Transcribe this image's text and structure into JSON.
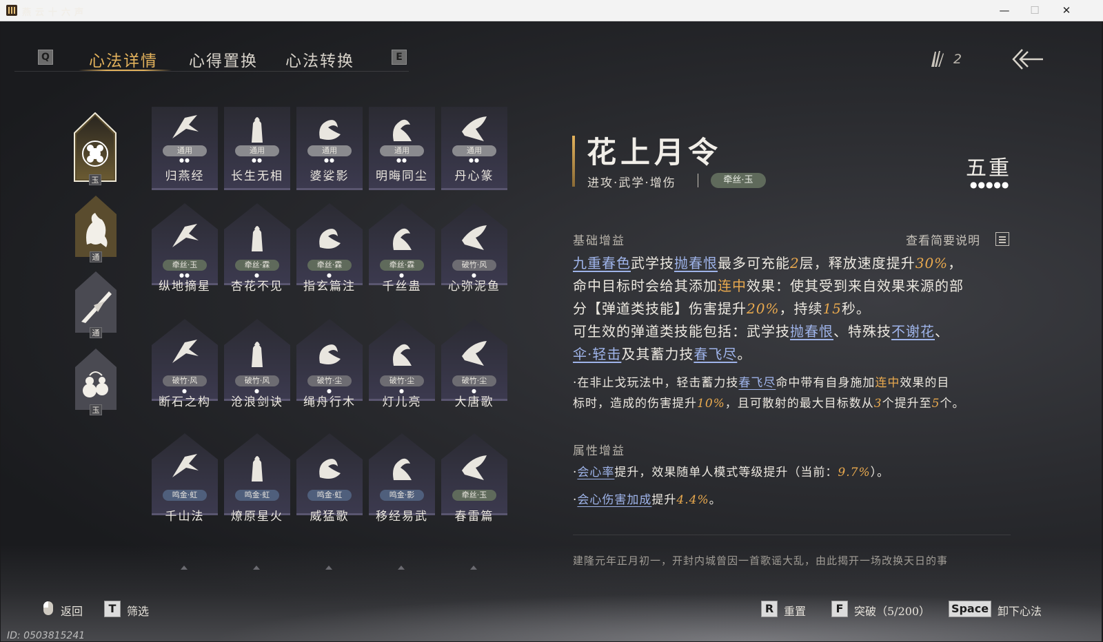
{
  "window": {
    "title": "燕云十六声",
    "minimize": "—",
    "maximize": "☐",
    "close": "✕"
  },
  "tabs": {
    "left_key": "Q",
    "right_key": "E",
    "items": [
      {
        "label": "心法详情",
        "active": true
      },
      {
        "label": "心得置换",
        "active": false
      },
      {
        "label": "心法转换",
        "active": false
      }
    ]
  },
  "currency": {
    "count": "2"
  },
  "categories": [
    {
      "icon": "flower-emblem-icon",
      "badge": "玉",
      "selected": true
    },
    {
      "icon": "horse-icon",
      "badge": "通",
      "selected": false
    },
    {
      "icon": "blade-icon",
      "badge": "通",
      "selected": false
    },
    {
      "icon": "gourd-icon",
      "badge": "玉",
      "selected": false
    }
  ],
  "skills": [
    [
      {
        "name": "归燕经",
        "tag": "通用",
        "tag_color": "#8a8a8e",
        "dots": "●●"
      },
      {
        "name": "长生无相",
        "tag": "通用",
        "tag_color": "#8a8a8e",
        "dots": "●●"
      },
      {
        "name": "婆娑影",
        "tag": "通用",
        "tag_color": "#8a8a8e",
        "dots": "●●"
      },
      {
        "name": "明晦同尘",
        "tag": "通用",
        "tag_color": "#8a8a8e",
        "dots": "●●"
      },
      {
        "name": "丹心篆",
        "tag": "通用",
        "tag_color": "#8a8a8e",
        "dots": "●●"
      }
    ],
    [
      {
        "name": "纵地摘星",
        "tag": "牵丝·玉",
        "tag_color": "#5f6a5b",
        "dots": "●●"
      },
      {
        "name": "杏花不见",
        "tag": "牵丝·霖",
        "tag_color": "#5f6a5b",
        "dots": "●"
      },
      {
        "name": "指玄篇注",
        "tag": "牵丝·霖",
        "tag_color": "#5f6a5b",
        "dots": "●"
      },
      {
        "name": "千丝蛊",
        "tag": "牵丝·霖",
        "tag_color": "#5f6a5b",
        "dots": "●"
      },
      {
        "name": "心弥泥鱼",
        "tag": "破竹·风",
        "tag_color": "#6d6c72",
        "dots": "●"
      }
    ],
    [
      {
        "name": "断石之构",
        "tag": "破竹·风",
        "tag_color": "#6d6c72",
        "dots": "●"
      },
      {
        "name": "沧浪剑诀",
        "tag": "破竹·风",
        "tag_color": "#6d6c72",
        "dots": "●"
      },
      {
        "name": "绳舟行木",
        "tag": "破竹·尘",
        "tag_color": "#6d6c72",
        "dots": "●"
      },
      {
        "name": "灯儿亮",
        "tag": "破竹·尘",
        "tag_color": "#6d6c72",
        "dots": "●"
      },
      {
        "name": "大唐歌",
        "tag": "破竹·尘",
        "tag_color": "#6d6c72",
        "dots": "●"
      }
    ],
    [
      {
        "name": "千山法",
        "tag": "鸣金·虹",
        "tag_color": "#4f5f7c",
        "dots": ""
      },
      {
        "name": "燎原星火",
        "tag": "鸣金·虹",
        "tag_color": "#4f5f7c",
        "dots": ""
      },
      {
        "name": "威猛歌",
        "tag": "鸣金·虹",
        "tag_color": "#4f5f7c",
        "dots": ""
      },
      {
        "name": "移经易武",
        "tag": "鸣金·影",
        "tag_color": "#4f5f7c",
        "dots": ""
      },
      {
        "name": "春雷篇",
        "tag": "牵丝·玉",
        "tag_color": "#5f6a5b",
        "dots": ""
      }
    ]
  ],
  "detail": {
    "title": "花上月令",
    "subtitle": "进攻·武学·增伤",
    "tag": "牵丝·玉",
    "rank": "五重",
    "rank_dots": "●●●●●",
    "basic_heading": "基础增益",
    "view_desc": "查看简要说明",
    "main_text": {
      "l1a": "九重春色",
      "l1b": "武学技",
      "l1c": "抛春恨",
      "l1d": "最多可充能",
      "l1e": "2",
      "l1f": "层，释放速度提升",
      "l1g": "30%",
      "l1h": "，",
      "l2a": "命中目标时会给其添加",
      "l2b": "连中",
      "l2c": "效果：使其受到来自效果来源的部",
      "l3a": "分【弹道类技能】伤害提升",
      "l3b": "20%",
      "l3c": "，持续",
      "l3d": "15",
      "l3e": "秒。",
      "l4a": "可生效的弹道类技能包括：武学技",
      "l4b": "抛春恨",
      "l4c": "、特殊技",
      "l4d": "不谢花",
      "l4e": "、",
      "l5a": "伞·轻击",
      "l5b": "及其蓄力技",
      "l5c": "春飞尽",
      "l5d": "。"
    },
    "note_text": {
      "a": "·在非止戈玩法中，轻击蓄力技",
      "b": "春飞尽",
      "c": "命中带有自身施加",
      "d": "连中",
      "e": "效果的目",
      "f": "标时，造成的伤害提升",
      "g": "10%",
      "h": "，且可散射的最大目标数从",
      "i": "3",
      "j": "个提升至",
      "k": "5",
      "l": "个。"
    },
    "attr_heading": "属性增益",
    "attr1": {
      "a": "·",
      "b": "会心率",
      "c": "提升，效果随单人模式等级提升（当前：",
      "d": "9.7%",
      "e": "）。"
    },
    "attr2": {
      "a": "·",
      "b": "会心伤害加成",
      "c": "提升",
      "d": "4.4%",
      "e": "。"
    },
    "lore": "建隆元年正月初一，开封内城曾因一首歌谣大乱，由此揭开一场改换天日的事"
  },
  "footer": {
    "back": "返回",
    "filter_key": "T",
    "filter": "筛选",
    "reset_key": "R",
    "reset": "重置",
    "break_key": "F",
    "break": "突破（5/200）",
    "unload_key": "Space",
    "unload": "卸下心法",
    "id": "ID: 0503815241"
  }
}
